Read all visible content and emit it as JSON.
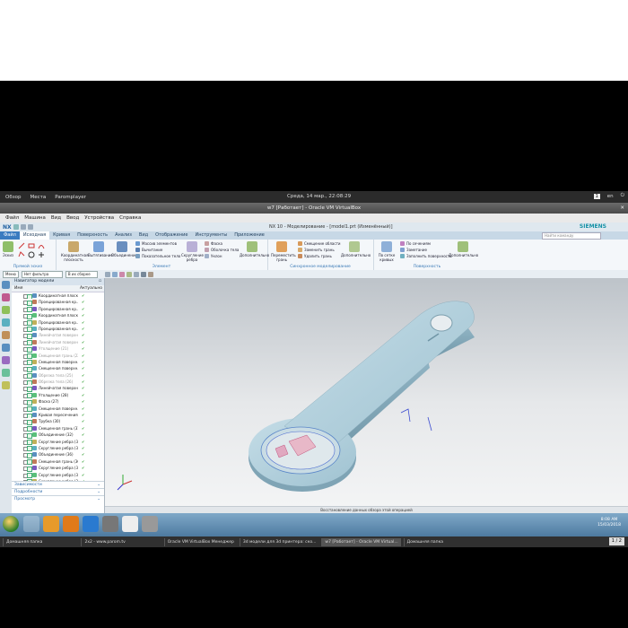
{
  "host": {
    "panel": {
      "overview": "Обзор",
      "places": "Места",
      "app": "Paromplayer",
      "clock": "Среда, 14 мар., 22:08:29",
      "workspace": "1",
      "lang": "en"
    },
    "taskbar": [
      {
        "label": "Домашняя папка"
      },
      {
        "label": "2x2 - www.parom.tv"
      },
      {
        "label": "Oracle VM VirtualBox Менеджер"
      },
      {
        "label": "3d модели для 3d принтера: ско..."
      },
      {
        "label": "w7 [Работает] - Oracle VM Virtual..."
      },
      {
        "label": "Домашняя папка"
      }
    ],
    "pager": "1 / 2"
  },
  "vm": {
    "title": "w7 [Работает] - Oracle VM VirtualBox",
    "menu": [
      "Файл",
      "Машина",
      "Вид",
      "Ввод",
      "Устройства",
      "Справка"
    ]
  },
  "nx": {
    "logo": "NX",
    "doc_title": "NX 10 - Моделирование - [model1.prt (Изменённый)]",
    "brand": "SIEMENS",
    "tabs": [
      "Файл",
      "Исходная",
      "Кривая",
      "Поверхность",
      "Анализ",
      "Вид",
      "Отображение",
      "Инструменты",
      "Приложение"
    ],
    "search_placeholder": "Найти команду",
    "ribbon": {
      "sketch_group": {
        "btn1": "Эскиз",
        "label": "Прямой эскиз"
      },
      "feature_group": {
        "btn_datum": "Координатная плоскость",
        "btn_extrude": "Вытягивание",
        "btn_unite": "Объединение",
        "small": [
          "Массив элементов",
          "Вычитание",
          "Показательное тело"
        ],
        "btn_blend": "Скругление ребра",
        "small2": [
          "Фаска",
          "Оболочка тела",
          "Уклон"
        ],
        "btn_more": "Дополнительно",
        "label": "Элемент"
      },
      "sync_group": {
        "btn_move": "Переместить грань",
        "small": [
          "Смещение области",
          "Заменить грань",
          "Удалить грань"
        ],
        "btn_more": "Дополнительно",
        "label": "Синхронное моделирование"
      },
      "surface_group": {
        "btn_curve": "По сетке кривых",
        "small": [
          "По сечениям",
          "Заметание",
          "Заполнить поверхность"
        ],
        "btn_more": "Дополнительно",
        "label": "Поверхность"
      }
    },
    "toolbar": {
      "menu": "Меню",
      "filter": "Нет фильтра выбора",
      "scope": "В их сборке"
    },
    "navigator": {
      "title": "Навигатор модели",
      "col_name": "Имя",
      "col_status": "Актуально",
      "rows": [
        {
          "label": "Координатная плоск...",
          "dim": false
        },
        {
          "label": "Проецированная кр...",
          "dim": false
        },
        {
          "label": "Проецированная кр...",
          "dim": false
        },
        {
          "label": "Координатная плоск...",
          "dim": false
        },
        {
          "label": "Проецированная кр...",
          "dim": false
        },
        {
          "label": "Проецированная кр...",
          "dim": false
        },
        {
          "label": "Линейчатая поверхн...",
          "dim": true
        },
        {
          "label": "Линейчатая поверхн...",
          "dim": true
        },
        {
          "label": "Утолщение (21)",
          "dim": true
        },
        {
          "label": "Смещенная грань (22)",
          "dim": true
        },
        {
          "label": "Смещенная поверхн...",
          "dim": false
        },
        {
          "label": "Смещенная поверхн...",
          "dim": false
        },
        {
          "label": "Обрезка тела (25)",
          "dim": true
        },
        {
          "label": "Обрезка тела (26)",
          "dim": true
        },
        {
          "label": "Линейчатая поверхн...",
          "dim": false
        },
        {
          "label": "Утолщение (28)",
          "dim": false
        },
        {
          "label": "Фаска (27)",
          "dim": false
        },
        {
          "label": "Смещенная поверхн...",
          "dim": false
        },
        {
          "label": "Кривая пересечения...",
          "dim": false
        },
        {
          "label": "Трубка (30)",
          "dim": false
        },
        {
          "label": "Смещенная грань (31)",
          "dim": false
        },
        {
          "label": "Объединение (32)",
          "dim": false
        },
        {
          "label": "Скругление ребра (33)",
          "dim": false
        },
        {
          "label": "Скругление ребра (34)",
          "dim": false
        },
        {
          "label": "Объединение (36)",
          "dim": false
        },
        {
          "label": "Смещенная грань (36)",
          "dim": false
        },
        {
          "label": "Скругление ребра (37)",
          "dim": false
        },
        {
          "label": "Скругление ребра (38)",
          "dim": false
        },
        {
          "label": "Скругление ребра (39)",
          "dim": false
        }
      ],
      "panels": [
        "Зависимости",
        "Подробности",
        "Просмотр"
      ]
    },
    "status": "Восстановление данных обзора этой операцией"
  },
  "win": {
    "clock_time": "8:08 AM",
    "clock_date": "15/03/2018"
  },
  "colors": {
    "accent": "#3a7bc0",
    "part": "#a9cbd8",
    "ok": "#2a9a2a"
  }
}
